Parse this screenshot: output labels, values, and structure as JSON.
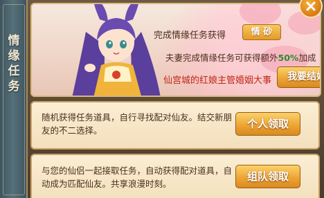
{
  "side_title": [
    "情",
    "缘",
    "任",
    "务"
  ],
  "banner": {
    "line1_text": "完成情缘任务获得",
    "qingsha_label": "情 砂",
    "line2_prefix": "夫妻完成情缘任务可获得额外",
    "line2_percent": "50%",
    "line2_suffix": "加成",
    "line3_text": "仙宫城的红娘主管婚姻大事",
    "marry_button": "我要结婚"
  },
  "tasks": [
    {
      "text": "随机获得任务道具，自行寻找配对仙友。结交新朋友的不二选择。",
      "button": "个人领取"
    },
    {
      "text": "与您的仙侣一起接取任务，自动获得配对道具，自动成为匹配仙友。共享浪漫时刻。",
      "button": "组队领取"
    }
  ],
  "icons": {
    "close": "close-icon",
    "character": "matchmaker-character-illustration"
  },
  "colors": {
    "accent_orange": "#eda635",
    "highlight_red": "#c02818",
    "highlight_green": "#2f8a2a"
  }
}
